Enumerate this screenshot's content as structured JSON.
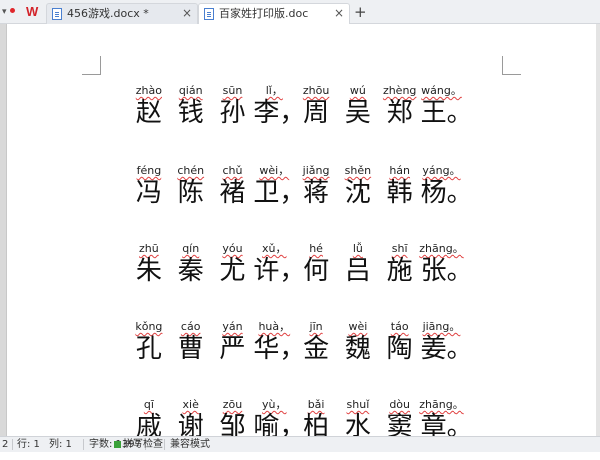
{
  "tabs": [
    {
      "label": "456游戏.docx *",
      "close": "×",
      "active": false
    },
    {
      "label": "百家姓打印版.doc",
      "close": "×",
      "active": true
    }
  ],
  "new_tab": "+",
  "app_logo": "W",
  "lines": [
    [
      {
        "py": "zhào",
        "hz": "赵"
      },
      {
        "py": "qián",
        "hz": "钱"
      },
      {
        "py": "sūn",
        "hz": "孙"
      },
      {
        "py": "lǐ，",
        "hz": "李，"
      },
      {
        "py": "zhōu",
        "hz": "周"
      },
      {
        "py": "wú",
        "hz": "吴"
      },
      {
        "py": "zhèng",
        "hz": "郑"
      },
      {
        "py": "wáng。",
        "hz": "王。"
      }
    ],
    [
      {
        "py": "féng",
        "hz": "冯"
      },
      {
        "py": "chén",
        "hz": "陈"
      },
      {
        "py": "chǔ",
        "hz": "褚"
      },
      {
        "py": "wèi，",
        "hz": "卫，"
      },
      {
        "py": "jiǎng",
        "hz": "蒋"
      },
      {
        "py": "shěn",
        "hz": "沈"
      },
      {
        "py": "hán",
        "hz": "韩"
      },
      {
        "py": "yáng。",
        "hz": "杨。"
      }
    ],
    [
      {
        "py": "zhū",
        "hz": "朱"
      },
      {
        "py": "qín",
        "hz": "秦"
      },
      {
        "py": "yóu",
        "hz": "尤"
      },
      {
        "py": "xǔ，",
        "hz": "许，"
      },
      {
        "py": "hé",
        "hz": "何"
      },
      {
        "py": "lǚ",
        "hz": "吕"
      },
      {
        "py": "shī",
        "hz": "施"
      },
      {
        "py": "zhāng。",
        "hz": "张。"
      }
    ],
    [
      {
        "py": "kǒng",
        "hz": "孔"
      },
      {
        "py": "cáo",
        "hz": "曹"
      },
      {
        "py": "yán",
        "hz": "严"
      },
      {
        "py": "huà，",
        "hz": "华，"
      },
      {
        "py": "jīn",
        "hz": "金"
      },
      {
        "py": "wèi",
        "hz": "魏"
      },
      {
        "py": "táo",
        "hz": "陶"
      },
      {
        "py": "jiāng。",
        "hz": "姜。"
      }
    ],
    [
      {
        "py": "qī",
        "hz": "戚"
      },
      {
        "py": "xiè",
        "hz": "谢"
      },
      {
        "py": "zōu",
        "hz": "邹"
      },
      {
        "py": "yù，",
        "hz": "喻，"
      },
      {
        "py": "bǎi",
        "hz": "柏"
      },
      {
        "py": "shuǐ",
        "hz": "水"
      },
      {
        "py": "dòu",
        "hz": "窦"
      },
      {
        "py": "zhāng。",
        "hz": "章。"
      }
    ]
  ],
  "status": {
    "page": "2",
    "row": "行: 1",
    "col": "列: 1",
    "words": "字数: 1397",
    "spell": "拼写检查",
    "compat": "兼容模式"
  },
  "colors": {
    "spell_underline": "#e04040",
    "logo": "#d3232a",
    "spell_ok": "#3aa13a"
  }
}
